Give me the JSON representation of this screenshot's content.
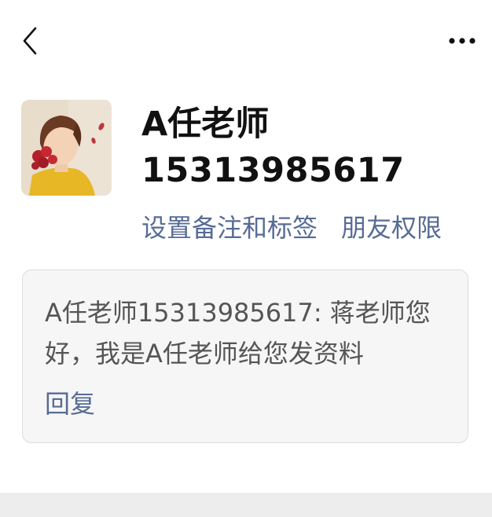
{
  "nav": {
    "back_icon": "chevron-left-icon",
    "more_icon": "ellipsis-icon"
  },
  "profile": {
    "avatar_icon": "avatar-image",
    "name": "A任老师",
    "wechat_id": "15313985617"
  },
  "actions": {
    "set_remark_label": "设置备注和标签",
    "friend_permissions_label": "朋友权限"
  },
  "message": {
    "text": "A任老师15313985617: 蒋老师您好，我是A任老师给您发资料",
    "reply_label": "回复"
  },
  "colors": {
    "link": "#576b95",
    "card_bg": "#f6f6f6",
    "card_border": "#dcdcdc",
    "text_primary": "#111111",
    "text_secondary": "#555555",
    "band": "#ededed"
  }
}
